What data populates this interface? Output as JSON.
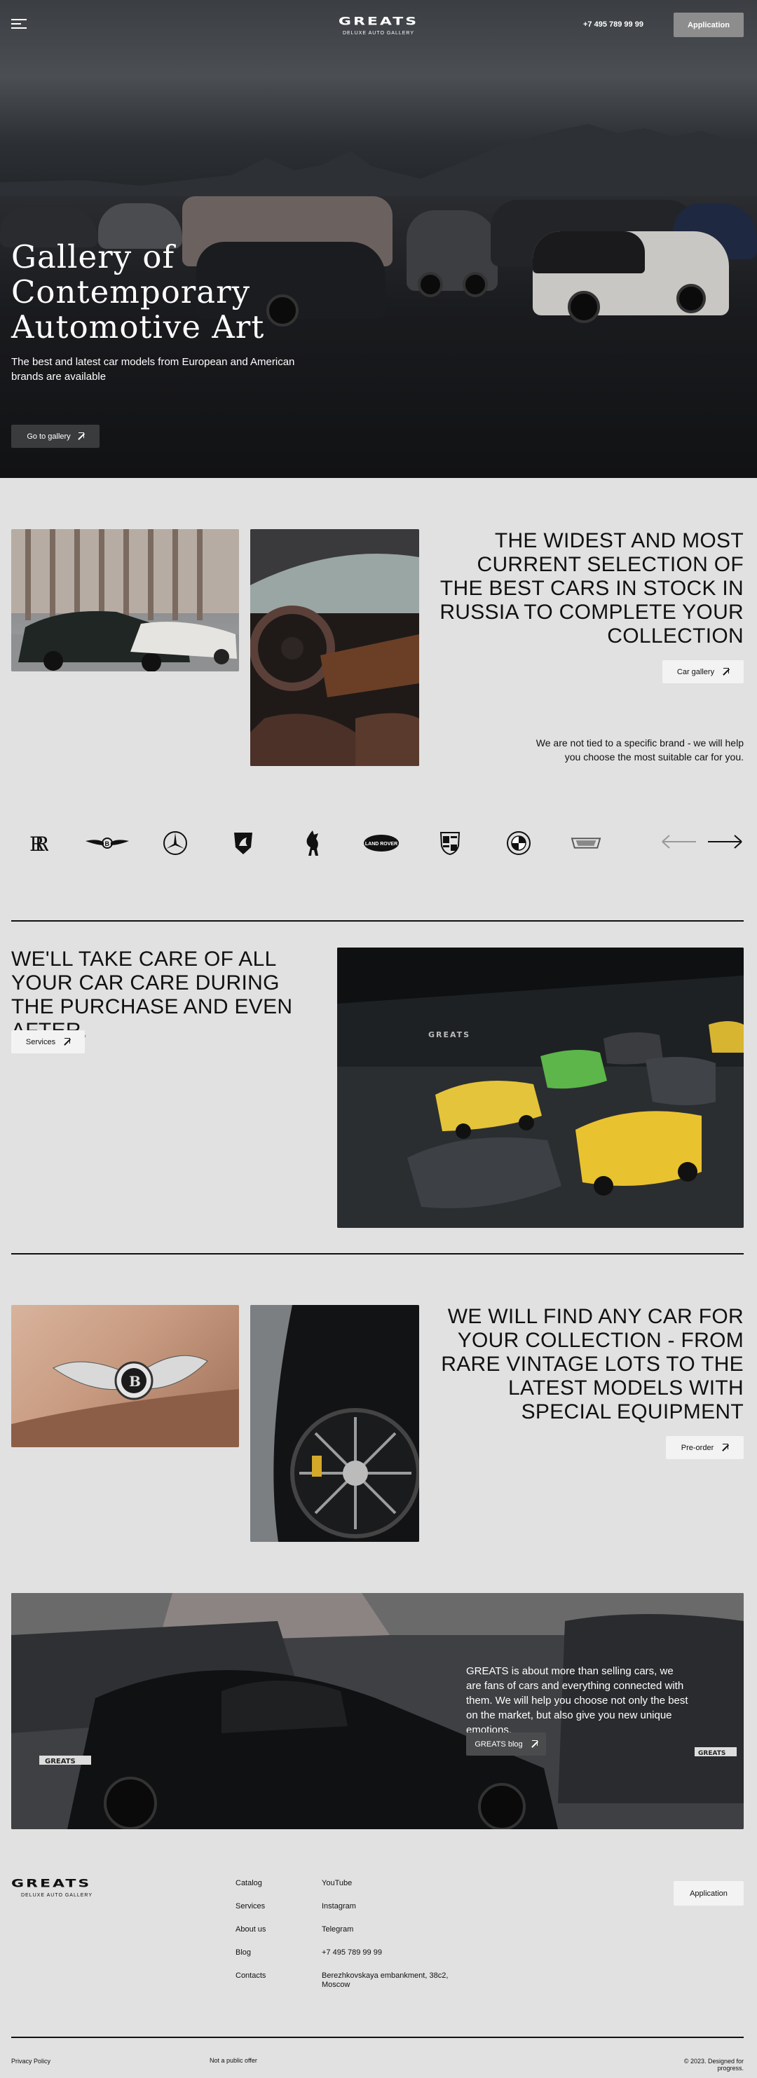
{
  "header": {
    "logo": "GREATS",
    "logo_tagline": "DELUXE AUTO GALLERY",
    "phone": "+7 495 789 99 99",
    "application_label": "Application"
  },
  "hero": {
    "title_lines": [
      "Gallery of",
      "Contemporary",
      "Automotive Art"
    ],
    "subtitle": "The best and latest car models from European and American brands are available",
    "button_label": "Go to gallery"
  },
  "selection": {
    "headline": "THE WIDEST AND MOST CURRENT SELECTION OF THE BEST CARS IN STOCK IN RUSSIA TO COMPLETE YOUR COLLECTION",
    "button_label": "Car gallery",
    "text": "We are not tied to a specific brand - we will help you choose the most suitable car for you."
  },
  "brands": {
    "items": [
      "rolls-royce",
      "bentley",
      "mercedes-benz",
      "lamborghini",
      "ferrari",
      "land-rover",
      "porsche",
      "bmw",
      "cadillac"
    ],
    "land_rover_label": "LAND ROVER"
  },
  "services": {
    "headline": "WE'LL TAKE CARE OF ALL YOUR CAR CARE DURING THE PURCHASE AND EVEN AFTER.",
    "button_label": "Services",
    "wall_sign": "GREATS"
  },
  "find": {
    "headline": "WE WILL FIND ANY CAR FOR YOUR COLLECTION - FROM RARE VINTAGE LOTS TO THE LATEST MODELS WITH SPECIAL EQUIPMENT",
    "button_label": "Pre-order"
  },
  "blog": {
    "text": "GREATS is about more than selling cars, we are fans of cars and everything connected with them. We will help you choose not only the best on the market, but also give you new unique emotions.",
    "button_label": "GREATS blog",
    "plate": "GREATS",
    "plate2": "GREATS"
  },
  "footer": {
    "logo": "GREATS",
    "logo_tagline": "DELUXE AUTO GALLERY",
    "nav": [
      "Catalog",
      "Services",
      "About us",
      "Blog",
      "Contacts"
    ],
    "contacts": [
      "YouTube",
      "Instagram",
      "Telegram",
      "+7 495 789 99 99",
      "Berezhkovskaya embankment, 38c2, Moscow"
    ],
    "application_label": "Application",
    "privacy": "Privacy Policy",
    "offer": "Not a public offer",
    "copyright": "© 2023. Designed for progress."
  },
  "colors": {
    "page_bg": "#e1e1e1",
    "hero_dark": "#141517",
    "button_dark": "#3a3b3d",
    "button_light": "#f3f3f3",
    "accent_yellow": "#e4c43a",
    "accent_green": "#5cb64a"
  }
}
